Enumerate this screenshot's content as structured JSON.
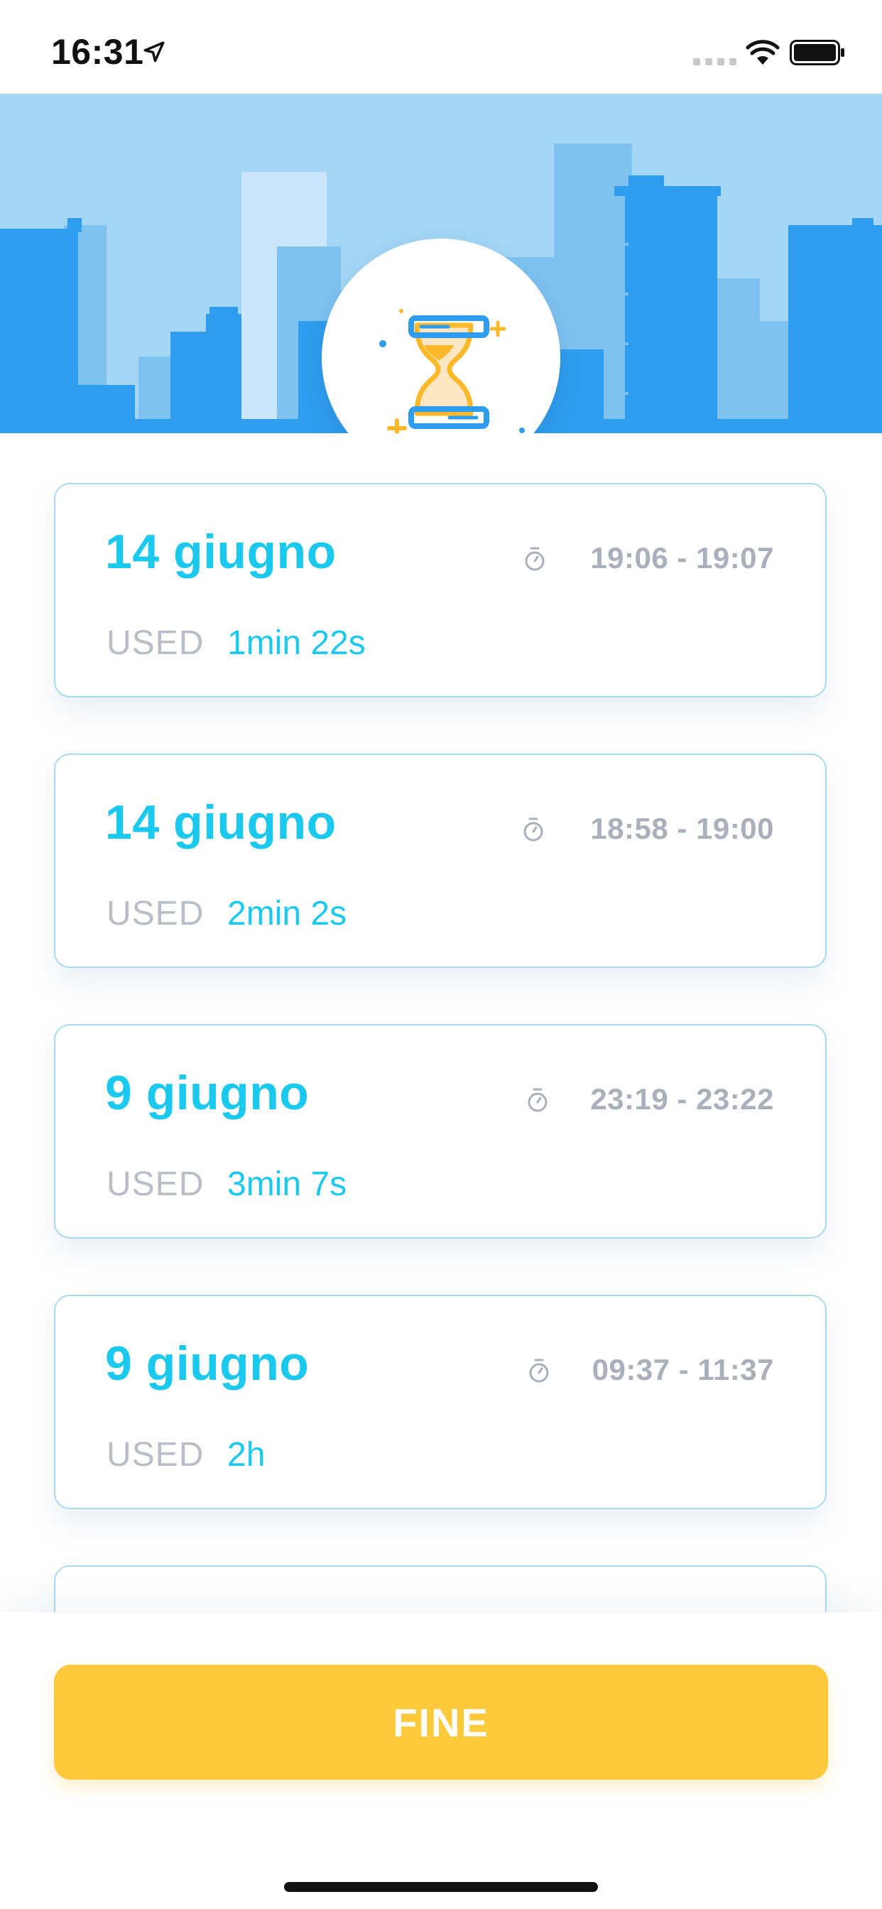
{
  "status_bar": {
    "time": "16:31",
    "icons": [
      "location-arrow-icon",
      "signal-icon",
      "wifi-icon",
      "battery-icon"
    ]
  },
  "header": {
    "logo_icon": "hourglass-icon",
    "colors": {
      "sky": "#a5d6f6",
      "city_light": "#7fc2f0",
      "city_dark": "#2f9ded",
      "hourglass_blue": "#2f9ded",
      "hourglass_yellow": "#fbb92a"
    }
  },
  "sessions": [
    {
      "date": "14 giugno",
      "time_range": "19:06 - 19:07",
      "used_label": "USED",
      "used_value": "1min 22s"
    },
    {
      "date": "14 giugno",
      "time_range": "18:58 - 19:00",
      "used_label": "USED",
      "used_value": "2min 2s"
    },
    {
      "date": "9 giugno",
      "time_range": "23:19 - 23:22",
      "used_label": "USED",
      "used_value": "3min 7s"
    },
    {
      "date": "9 giugno",
      "time_range": "09:37 - 11:37",
      "used_label": "USED",
      "used_value": "2h"
    },
    {
      "date": "",
      "time_range": "",
      "used_label": "",
      "used_value": ""
    }
  ],
  "actions": {
    "done_label": "FINE"
  },
  "colors": {
    "accent": "#1bc8ee",
    "muted_text": "#a9b0bb",
    "card_border": "#a8daf3",
    "button": "#fec93a",
    "button_text": "#ffffff"
  }
}
